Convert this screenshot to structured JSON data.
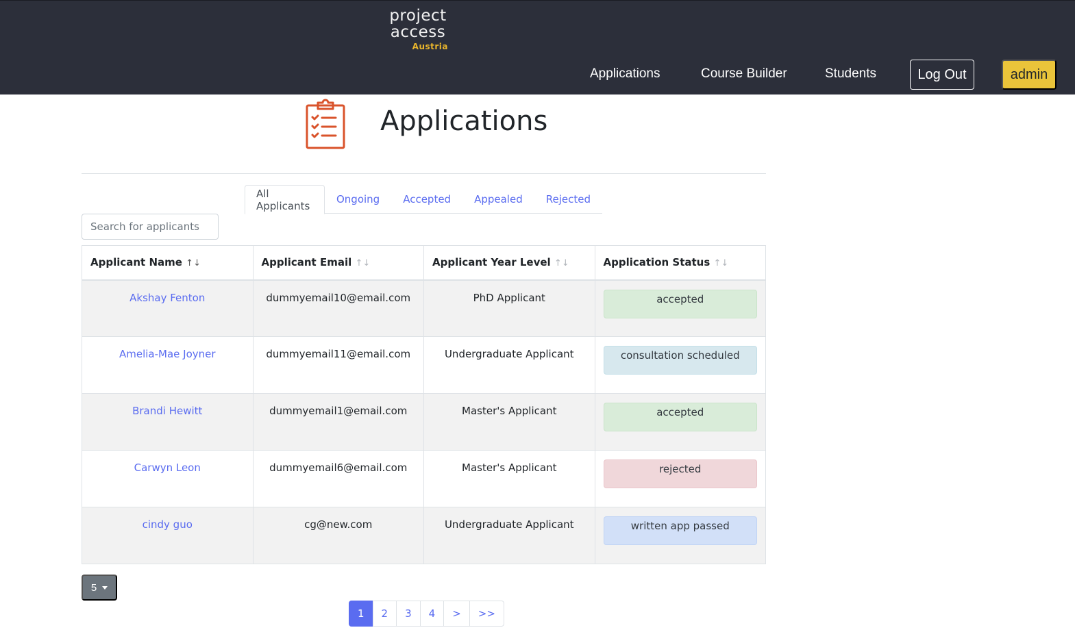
{
  "brand": {
    "line1": "project",
    "line2": "access",
    "sub": "Austria"
  },
  "nav": {
    "links": [
      "Applications",
      "Course Builder",
      "Students"
    ],
    "logout": "Log Out",
    "user": "admin"
  },
  "page": {
    "title": "Applications",
    "icon": "clipboard-checklist-icon"
  },
  "tabs": [
    {
      "label": "All Applicants",
      "active": true
    },
    {
      "label": "Ongoing",
      "active": false
    },
    {
      "label": "Accepted",
      "active": false
    },
    {
      "label": "Appealed",
      "active": false
    },
    {
      "label": "Rejected",
      "active": false
    }
  ],
  "search": {
    "placeholder": "Search for applicants",
    "value": ""
  },
  "table": {
    "columns": [
      {
        "label": "Applicant Name",
        "sort_icon": "↑↓"
      },
      {
        "label": "Applicant Email",
        "sort_icon": "↑↓"
      },
      {
        "label": "Applicant Year Level",
        "sort_icon": "↑↓"
      },
      {
        "label": "Application Status",
        "sort_icon": "↑↓"
      }
    ],
    "rows": [
      {
        "name": "Akshay Fenton",
        "email": "dummyemail10@email.com",
        "year": "PhD Applicant",
        "status": "accepted",
        "status_kind": "success"
      },
      {
        "name": "Amelia-Mae Joyner",
        "email": "dummyemail11@email.com",
        "year": "Undergraduate Applicant",
        "status": "consultation scheduled",
        "status_kind": "info"
      },
      {
        "name": "Brandi Hewitt",
        "email": "dummyemail1@email.com",
        "year": "Master's Applicant",
        "status": "accepted",
        "status_kind": "success"
      },
      {
        "name": "Carwyn Leon",
        "email": "dummyemail6@email.com",
        "year": "Master's Applicant",
        "status": "rejected",
        "status_kind": "danger"
      },
      {
        "name": "cindy guo",
        "email": "cg@new.com",
        "year": "Undergraduate Applicant",
        "status": "written app passed",
        "status_kind": "primary"
      }
    ]
  },
  "status_colors": {
    "success": {
      "bg": "#d9ecd9",
      "border": "#c9e4c9"
    },
    "info": {
      "bg": "#d7e8ee",
      "border": "#c3dfe8"
    },
    "danger": {
      "bg": "#f0d7da",
      "border": "#eac5ca"
    },
    "primary": {
      "bg": "#d2e0f8",
      "border": "#bfd3f5"
    }
  },
  "page_size": {
    "value": "5"
  },
  "pagination": {
    "items": [
      "1",
      "2",
      "3",
      "4",
      ">",
      ">>"
    ],
    "active": "1"
  },
  "colors": {
    "navbar": "#2c2f3a",
    "accent": "#5a6cf0",
    "admin_button": "#eac43a",
    "icon_orange": "#d9532b"
  }
}
